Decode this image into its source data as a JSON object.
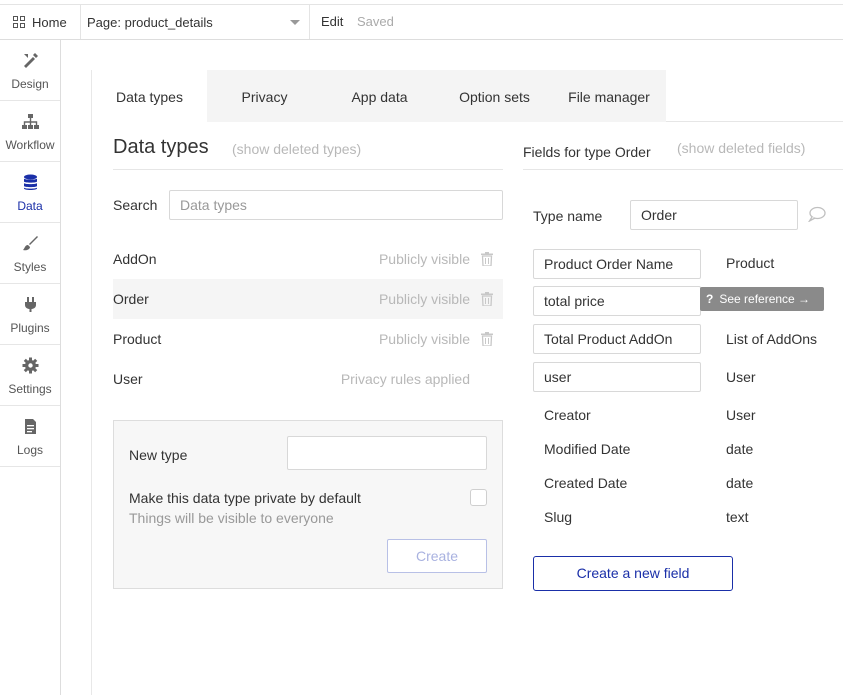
{
  "topbar": {
    "home_label": "Home",
    "page_label": "Page: product_details",
    "edit_label": "Edit",
    "status_label": "Saved"
  },
  "sidebar": {
    "items": [
      {
        "label": "Design",
        "icon": "design-icon",
        "active": false
      },
      {
        "label": "Workflow",
        "icon": "workflow-icon",
        "active": false
      },
      {
        "label": "Data",
        "icon": "database-icon",
        "active": true
      },
      {
        "label": "Styles",
        "icon": "brush-icon",
        "active": false
      },
      {
        "label": "Plugins",
        "icon": "plug-icon",
        "active": false
      },
      {
        "label": "Settings",
        "icon": "gear-icon",
        "active": false
      },
      {
        "label": "Logs",
        "icon": "document-icon",
        "active": false
      }
    ],
    "accent_color": "#1a2fa8"
  },
  "tabs": [
    {
      "label": "Data types",
      "active": true
    },
    {
      "label": "Privacy",
      "active": false
    },
    {
      "label": "App data",
      "active": false
    },
    {
      "label": "Option sets",
      "active": false
    },
    {
      "label": "File manager",
      "active": false
    }
  ],
  "data_types": {
    "title": "Data types",
    "show_deleted": "(show deleted types)",
    "search_label": "Search",
    "search_placeholder": "Data types",
    "types": [
      {
        "name": "AddOn",
        "status": "Publicly visible",
        "deletable": true,
        "selected": false
      },
      {
        "name": "Order",
        "status": "Publicly visible",
        "deletable": true,
        "selected": true
      },
      {
        "name": "Product",
        "status": "Publicly visible",
        "deletable": true,
        "selected": false
      },
      {
        "name": "User",
        "status": "Privacy rules applied",
        "deletable": false,
        "selected": false
      }
    ],
    "new_type": {
      "label": "New type",
      "value": "",
      "private_label": "Make this data type private by default",
      "private_sub": "Things will be visible to everyone",
      "private_checked": false,
      "create_label": "Create"
    }
  },
  "fields": {
    "title": "Fields for type Order",
    "show_deleted": "(show deleted fields)",
    "type_name_label": "Type name",
    "type_name_value": "Order",
    "custom_fields": [
      {
        "name": "Product Order Name",
        "type": "Product"
      },
      {
        "name": "total price",
        "type": "",
        "tooltip": "See reference →"
      },
      {
        "name": "Total Product AddOn",
        "type": "List of AddOns"
      },
      {
        "name": "user",
        "type": "User"
      }
    ],
    "builtin_fields": [
      {
        "name": "Creator",
        "type": "User"
      },
      {
        "name": "Modified Date",
        "type": "date"
      },
      {
        "name": "Created Date",
        "type": "date"
      },
      {
        "name": "Slug",
        "type": "text"
      }
    ],
    "create_field_label": "Create a new field"
  }
}
